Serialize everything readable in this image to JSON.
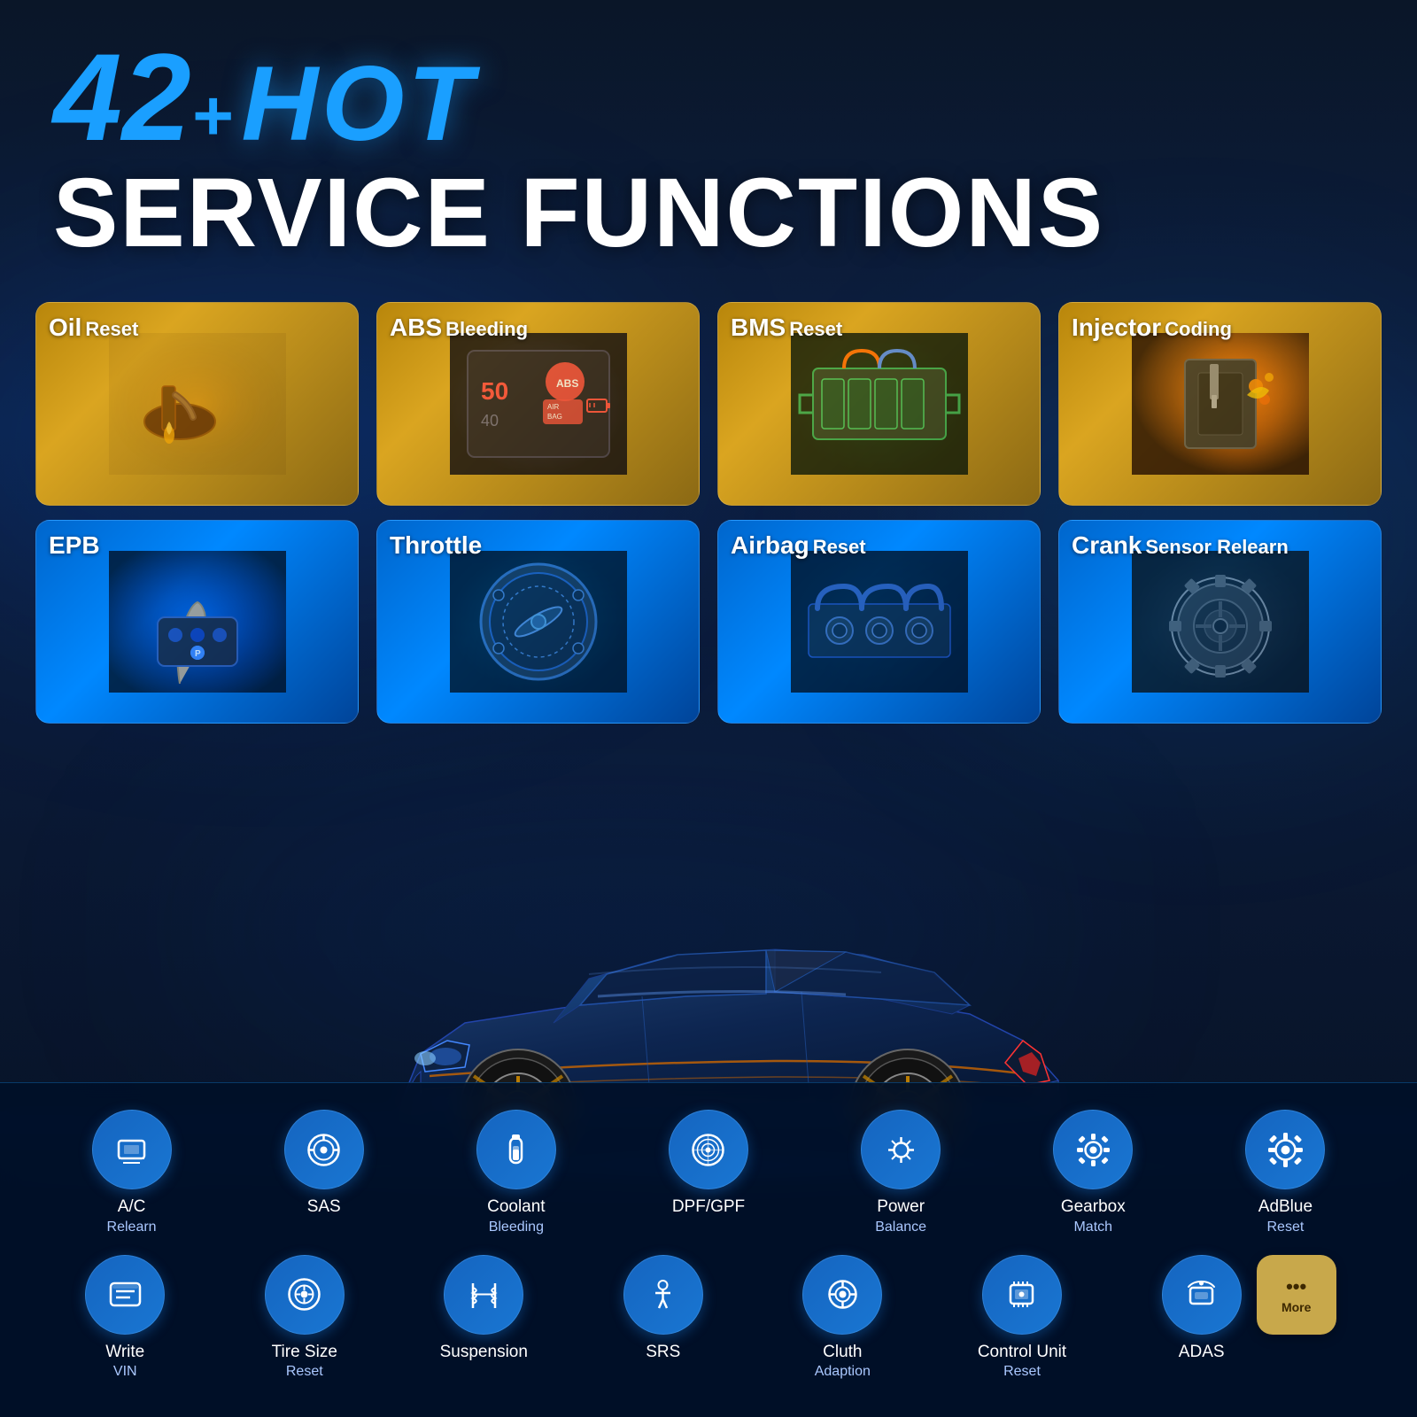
{
  "header": {
    "number": "42",
    "plus": "+",
    "hot": "HOT",
    "service_functions": "SERVICE FUNCTIONS"
  },
  "top_cards": [
    {
      "id": "oil-reset",
      "bold": "Oil",
      "label": "Reset",
      "style": "gold",
      "emoji": "🛢️"
    },
    {
      "id": "abs-bleeding",
      "bold": "ABS",
      "label": "Bleeding",
      "style": "gold",
      "emoji": "🔴"
    },
    {
      "id": "bms-reset",
      "bold": "BMS",
      "label": "Reset",
      "style": "gold",
      "emoji": "🔋"
    },
    {
      "id": "injector-coding",
      "bold": "Injector",
      "label": "Coding",
      "style": "gold",
      "emoji": "🔥"
    }
  ],
  "bottom_cards": [
    {
      "id": "epb",
      "bold": "EPB",
      "label": "",
      "style": "blue",
      "emoji": "🅿️"
    },
    {
      "id": "throttle",
      "bold": "Throttle",
      "label": "",
      "style": "blue",
      "emoji": "⚙️"
    },
    {
      "id": "airbag-reset",
      "bold": "Airbag",
      "label": "Reset",
      "style": "blue",
      "emoji": "💨"
    },
    {
      "id": "crank-sensor-relearn",
      "bold": "Crank",
      "label": "Sensor Relearn",
      "style": "blue",
      "emoji": "🔧"
    }
  ],
  "icons_row1": [
    {
      "id": "ac-relearn",
      "icon": "monitor",
      "label": "A/C",
      "sublabel": "Relearn"
    },
    {
      "id": "sas",
      "icon": "steering",
      "label": "SAS",
      "sublabel": ""
    },
    {
      "id": "coolant-bleeding",
      "icon": "thermometer",
      "label": "Coolant",
      "sublabel": "Bleeding"
    },
    {
      "id": "dpf-gpf",
      "icon": "filter",
      "label": "DPF/GPF",
      "sublabel": ""
    },
    {
      "id": "power-balance",
      "icon": "power",
      "label": "Power",
      "sublabel": "Balance"
    },
    {
      "id": "gearbox-match",
      "icon": "gearbox",
      "label": "Gearbox",
      "sublabel": "Match"
    },
    {
      "id": "adblue-reset",
      "icon": "gear",
      "label": "AdBlue",
      "sublabel": "Reset"
    }
  ],
  "icons_row2": [
    {
      "id": "write-vin",
      "icon": "barcode",
      "label": "Write",
      "sublabel": "VIN"
    },
    {
      "id": "tire-size-reset",
      "icon": "tire",
      "label": "Tire Size",
      "sublabel": "Reset"
    },
    {
      "id": "suspension",
      "icon": "suspension",
      "label": "Suspension",
      "sublabel": ""
    },
    {
      "id": "srs",
      "icon": "person",
      "label": "SRS",
      "sublabel": ""
    },
    {
      "id": "cluth-adaption",
      "icon": "clutch",
      "label": "Cluth",
      "sublabel": "Adaption"
    },
    {
      "id": "control-unit-reset",
      "icon": "control",
      "label": "Control Unit",
      "sublabel": "Reset"
    },
    {
      "id": "adas",
      "icon": "adas",
      "label": "ADAS",
      "sublabel": ""
    }
  ],
  "more_button": {
    "label": "More",
    "dots": "•••"
  }
}
